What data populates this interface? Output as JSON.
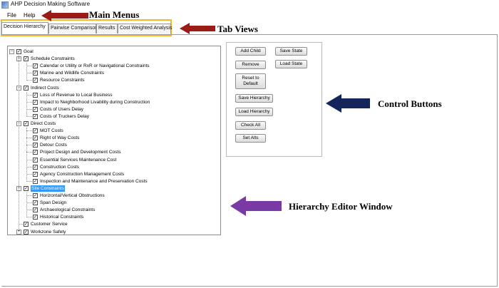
{
  "window": {
    "title": "AHP Decision Making Software",
    "icon": "app-icon"
  },
  "menus": [
    "File",
    "Help"
  ],
  "tabs": [
    "Decision Hierarchy",
    "Pairwise Comparison",
    "Results",
    "Cost Weighted Analysis"
  ],
  "tree": {
    "root": "Goal",
    "groups": [
      {
        "label": "Schedule Constraints",
        "children": [
          "Calendar or Utility or RxR or Navigational Constraints",
          "Marine and Wildlife Constraints",
          "Resource Constraints"
        ]
      },
      {
        "label": "Indirect Costs",
        "children": [
          "Loss of Revenue to Local Business",
          "Impact to Neighborhood Livability during Construction",
          "Costs of Users Delay",
          "Costs of Truckers Delay"
        ]
      },
      {
        "label": "Direct Costs",
        "children": [
          "MOT Costs",
          "Right of Way Costs",
          "Detour Costs",
          "Project Design and Development Costs",
          "Essential Services Maintenance Cost",
          "Construction Costs",
          "Agency Construction Management Costs",
          "Inspection and Maintenance and Preservation Costs"
        ]
      },
      {
        "label": "Site Constraints",
        "selected": true,
        "children": [
          "Horizontal/Vertical Obstructions",
          "Span Design",
          "Archaeological Constraints",
          "Historical Constraints"
        ]
      },
      {
        "label": "Customer Service",
        "children": []
      },
      {
        "label": "Workzone Safety",
        "collapsed": true,
        "children": []
      }
    ]
  },
  "buttons": {
    "add_child": "Add Child",
    "remove": "Remove",
    "reset_line1": "Reset to",
    "reset_line2": "Default",
    "save_hierarchy": "Save Hierarchy",
    "load_hierarchy": "Load Hierarchy",
    "check_all": "Check All",
    "set_alts": "Set Alts",
    "save_state": "Save State",
    "load_state": "Load State"
  },
  "annotations": {
    "main_menus": "Main Menus",
    "tab_views": "Tab Views",
    "control_buttons": "Control Buttons",
    "hierarchy_editor": "Hierarchy Editor Window"
  },
  "colors": {
    "highlight_box": "#f3b82b",
    "arrow_red": "#9b1b16",
    "arrow_navy": "#15245a",
    "arrow_purple": "#7a3aa6",
    "selection": "#3399ff"
  }
}
